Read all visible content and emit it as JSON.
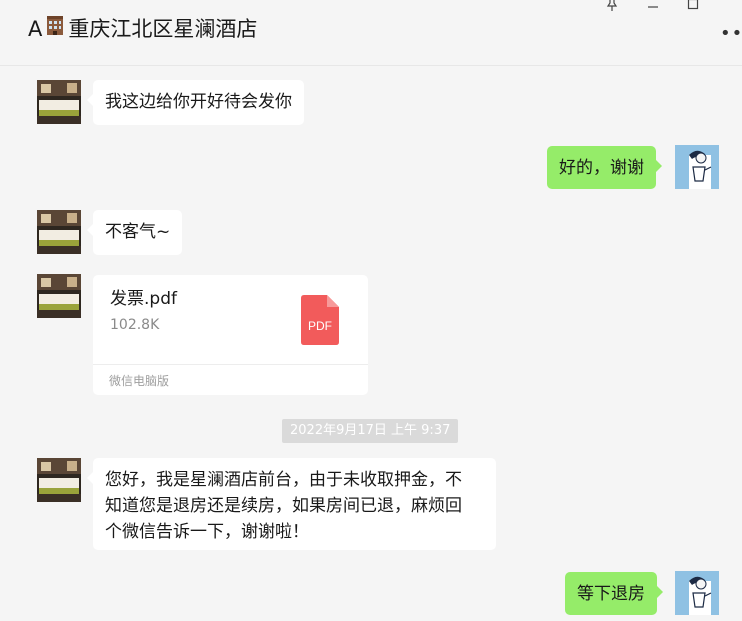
{
  "header": {
    "title_prefix": "A",
    "title_icon": "hotel-building-emoji",
    "title": "重庆江北区星澜酒店",
    "controls": [
      "pin-icon",
      "minimize-icon",
      "maximize-icon"
    ],
    "more_label": "•••"
  },
  "messages": [
    {
      "id": "m1",
      "direction": "in",
      "text": "我这边给你开好待会发你"
    },
    {
      "id": "m2",
      "direction": "out",
      "text": "好的，谢谢"
    },
    {
      "id": "m3",
      "direction": "in",
      "text": "不客气~"
    },
    {
      "id": "m4",
      "direction": "in",
      "type": "file",
      "file": {
        "name": "发票.pdf",
        "size": "102.8K",
        "icon_label": "PDF",
        "source": "微信电脑版"
      }
    },
    {
      "id": "ts",
      "type": "timestamp",
      "text": "2022年9月17日 上午 9:37"
    },
    {
      "id": "m5",
      "direction": "in",
      "lines": [
        "您好，我是星澜酒店前台，由于未收取押金，不",
        "知道您是退房还是续房，如果房间已退，麻烦回",
        "个微信告诉一下，谢谢啦！"
      ]
    },
    {
      "id": "m6",
      "direction": "out",
      "text": "等下退房"
    }
  ],
  "colors": {
    "background": "#f5f5f5",
    "incoming_bubble": "#ffffff",
    "outgoing_bubble": "#95ec69",
    "pdf_icon": "#f25b5b",
    "timestamp_bg": "#dadada"
  }
}
